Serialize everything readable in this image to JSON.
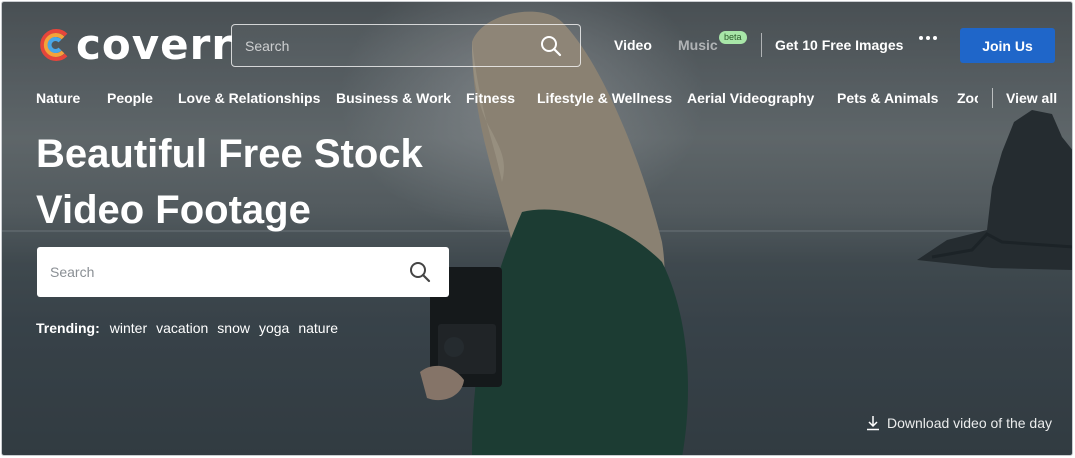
{
  "brand": {
    "name": "coverr"
  },
  "header": {
    "search_placeholder": "Search",
    "nav": {
      "video": "Video",
      "music": "Music",
      "music_badge": "beta",
      "free_images": "Get 10 Free Images"
    },
    "join_label": "Join Us"
  },
  "categories": {
    "items": [
      "Nature",
      "People",
      "Love & Relationships",
      "Business & Work",
      "Fitness",
      "Lifestyle & Wellness",
      "Aerial Videography",
      "Pets & Animals",
      "Zoo"
    ],
    "view_all": "View all"
  },
  "hero": {
    "title_line1": "Beautiful Free Stock",
    "title_line2": "Video Footage",
    "search_placeholder": "Search",
    "trending_label": "Trending:",
    "trending_tags": [
      "winter",
      "vacation",
      "snow",
      "yoga",
      "nature"
    ],
    "download_label": "Download video of the day"
  },
  "colors": {
    "accent": "#1f66c9",
    "beta_badge": "#a8e6a8",
    "text": "#ffffff"
  }
}
